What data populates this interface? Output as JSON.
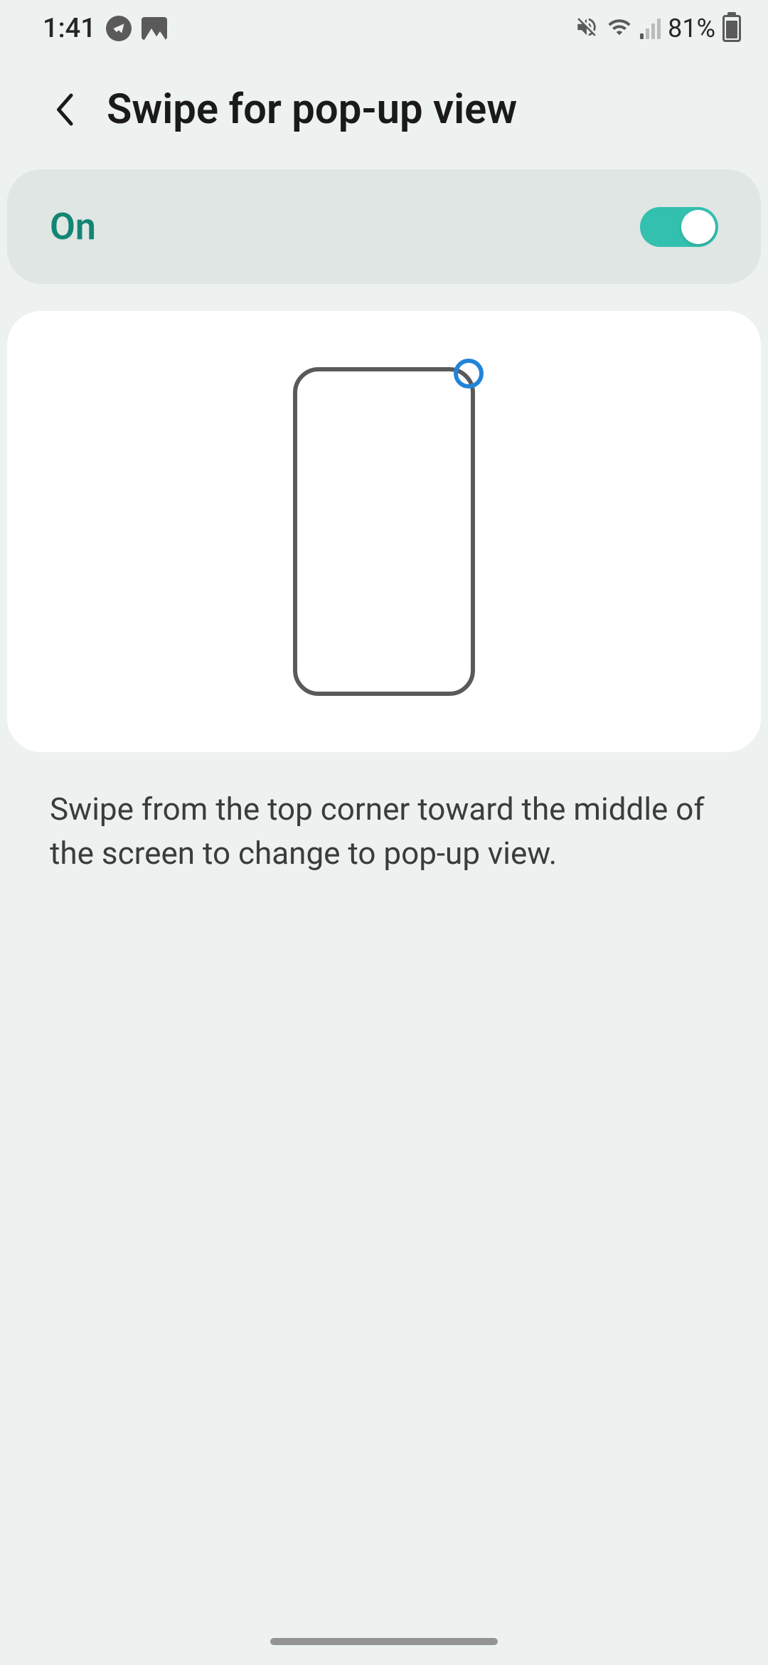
{
  "status_bar": {
    "time": "1:41",
    "battery_percent": "81%"
  },
  "header": {
    "title": "Swipe for pop-up view"
  },
  "toggle": {
    "state_label": "On",
    "enabled": true
  },
  "description": "Swipe from the top corner toward the middle of the screen to change to pop-up view."
}
